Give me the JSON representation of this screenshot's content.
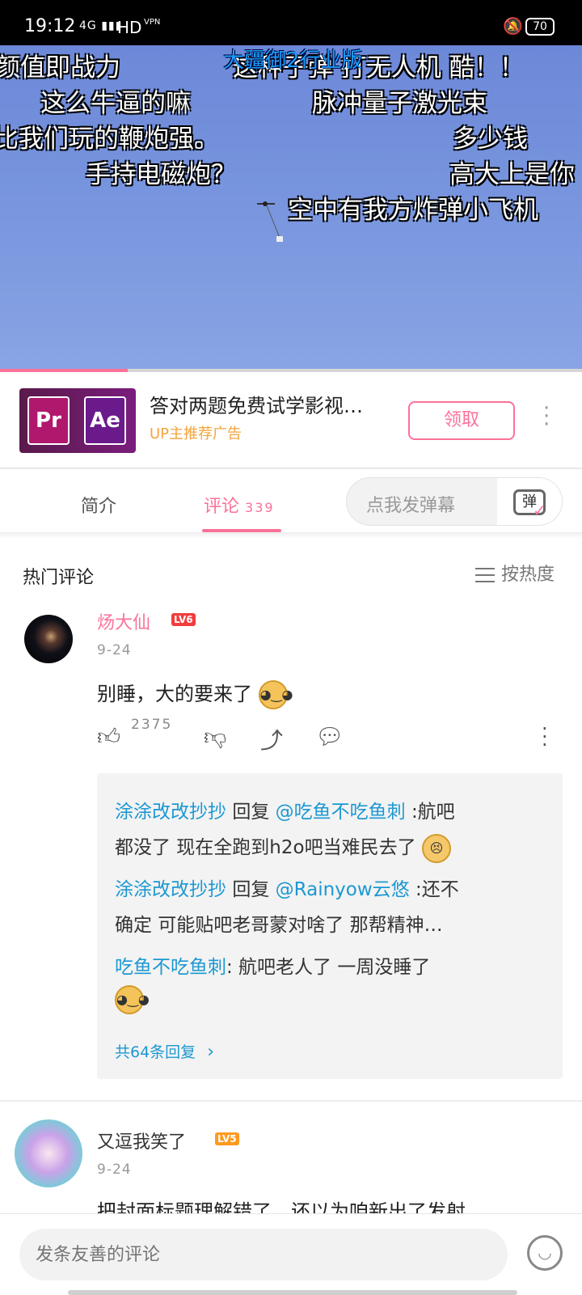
{
  "status_bar": {
    "time": "19:12",
    "network": "4G",
    "hd": "HD",
    "vpn": "VPN",
    "battery": "70"
  },
  "video": {
    "progress_percent": 22,
    "danmaku": [
      "颜值即战力",
      "这么牛逼的嘛",
      "比我们玩的鞭炮强。",
      "手持电磁炮？",
      "这种子弹 打无人机 酷！！",
      "脉冲量子激光束",
      "多少钱",
      "高大上是你",
      "空中有我方炸弹小飞机"
    ],
    "watermark": "大疆御2行业版"
  },
  "ad": {
    "logo_left": "Pr",
    "logo_right": "Ae",
    "title": "答对两题免费试学影视…",
    "subtitle": "UP主推荐广告",
    "button": "领取"
  },
  "tabs": {
    "intro": "简介",
    "comments": "评论",
    "comments_count": "339",
    "danmaku_placeholder": "点我发弹幕",
    "danmaku_icon": "弹"
  },
  "comments_header": {
    "title": "热门评论",
    "sort": "按热度"
  },
  "comments": [
    {
      "username": "炀大仙",
      "level": "LV6",
      "date": "9-24",
      "text": "别睡，大的要来了",
      "likes": "2375",
      "replies": [
        {
          "user": "涂涂改改抄抄",
          "verb": "回复",
          "target": "@吃鱼不吃鱼刺",
          "line1": ":航吧",
          "line2": "都没了 现在全跑到h2o吧当难民去了"
        },
        {
          "user": "涂涂改改抄抄",
          "verb": "回复",
          "target": "@Rainyow云悠",
          "line1": ":还不",
          "line2": "确定 可能贴吧老哥蒙对啥了 那帮精神…"
        },
        {
          "user": "吃鱼不吃鱼刺",
          "verb": "",
          "target": "",
          "line1": ": 航吧老人了 一周没睡了",
          "line2": ""
        }
      ],
      "reply_more": "共64条回复"
    },
    {
      "username": "又逗我笑了",
      "level": "LV5",
      "date": "9-24",
      "text": "把封面标题理解错了，还以为咱新出了发射"
    }
  ],
  "bottom": {
    "input_placeholder": "发条友善的评论"
  },
  "colors": {
    "accent": "#fb7299",
    "link": "#1c98d2",
    "lv6": "#f23c3c",
    "lv5": "#ff9a1f"
  }
}
